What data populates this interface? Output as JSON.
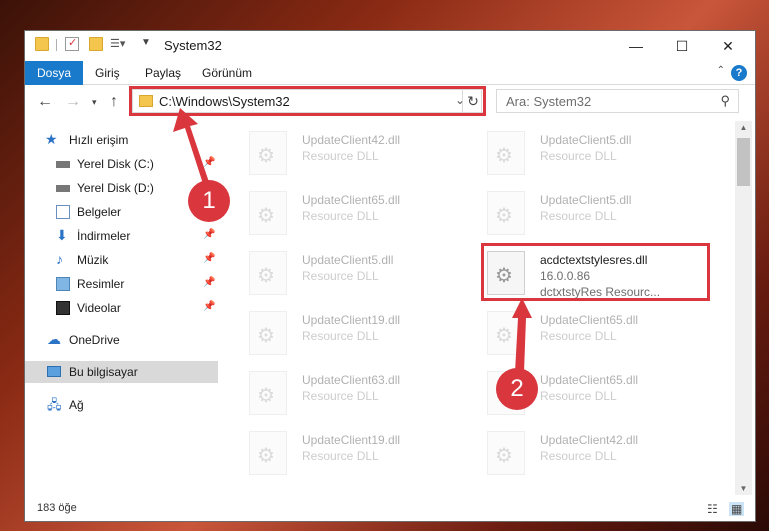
{
  "window": {
    "title": "System32",
    "controls": {
      "minimize": "—",
      "maximize": "☐",
      "close": "✕"
    }
  },
  "ribbon": {
    "tabs": [
      {
        "label": "Dosya",
        "active": true
      },
      {
        "label": "Giriş"
      },
      {
        "label": "Paylaş"
      },
      {
        "label": "Görünüm"
      }
    ],
    "help": "?"
  },
  "address": {
    "path": "C:\\Windows\\System32",
    "search_placeholder": "Ara: System32"
  },
  "nav": {
    "items": [
      {
        "label": "Hızlı erişim",
        "icon": "star-icon",
        "pinned": false
      },
      {
        "label": "Yerel Disk (C:)",
        "icon": "drive-icon",
        "pinned": true
      },
      {
        "label": "Yerel Disk (D:)",
        "icon": "drive-icon",
        "pinned": false
      },
      {
        "label": "Belgeler",
        "icon": "document-icon",
        "pinned": true
      },
      {
        "label": "İndirmeler",
        "icon": "download-icon",
        "pinned": true
      },
      {
        "label": "Müzik",
        "icon": "music-icon",
        "pinned": true
      },
      {
        "label": "Resimler",
        "icon": "pictures-icon",
        "pinned": true
      },
      {
        "label": "Videolar",
        "icon": "video-icon",
        "pinned": true
      },
      {
        "label": "OneDrive",
        "icon": "cloud-icon",
        "pinned": false
      },
      {
        "label": "Bu bilgisayar",
        "icon": "computer-icon",
        "pinned": false,
        "selected": true
      },
      {
        "label": "Ağ",
        "icon": "network-icon",
        "pinned": false
      }
    ]
  },
  "files": {
    "left": [
      {
        "name": "UpdateClient42.dll",
        "desc": "Resource DLL"
      },
      {
        "name": "UpdateClient65.dll",
        "desc": "Resource DLL"
      },
      {
        "name": "UpdateClient5.dll",
        "desc": "Resource DLL"
      },
      {
        "name": "UpdateClient19.dll",
        "desc": "Resource DLL"
      },
      {
        "name": "UpdateClient63.dll",
        "desc": "Resource DLL"
      },
      {
        "name": "UpdateClient19.dll",
        "desc": "Resource DLL"
      }
    ],
    "right": [
      {
        "name": "UpdateClient5.dll",
        "desc": "Resource DLL"
      },
      {
        "name": "UpdateClient5.dll",
        "desc": "Resource DLL"
      },
      {
        "name": "acdctextstylesres.dll",
        "desc": "16.0.0.86",
        "meta": "dctxtstyRes Resourc...",
        "highlight": true
      },
      {
        "name": "UpdateClient65.dll",
        "desc": "Resource DLL"
      },
      {
        "name": "UpdateClient65.dll",
        "desc": "Resource DLL"
      },
      {
        "name": "UpdateClient42.dll",
        "desc": "Resource DLL"
      }
    ]
  },
  "status": {
    "count": "183 öğe"
  },
  "annotations": {
    "step1": "1",
    "step2": "2",
    "color": "#d9363e"
  }
}
